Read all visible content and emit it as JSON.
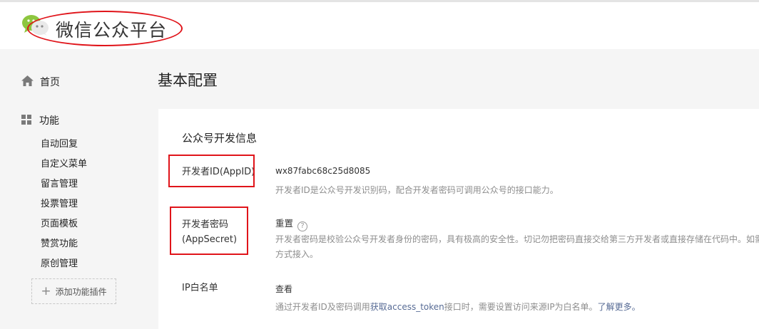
{
  "header": {
    "brand": "微信公众平台",
    "accent": "#8dc63f"
  },
  "sidebar": {
    "home": "首页",
    "function": "功能",
    "items": [
      "自动回复",
      "自定义菜单",
      "留言管理",
      "投票管理",
      "页面模板",
      "赞赏功能",
      "原创管理"
    ],
    "add_plugin": "添加功能插件"
  },
  "main": {
    "title": "基本配置",
    "section_title": "公众号开发信息",
    "appid": {
      "label": "开发者ID(AppID)",
      "value": "wx87fabc68c25d8085",
      "desc": "开发者ID是公众号开发识别码，配合开发者密码可调用公众号的接口能力。"
    },
    "secret": {
      "label_line1": "开发者密码",
      "label_line2": "(AppSecret)",
      "action": "重置",
      "help": "?",
      "desc_line1": "开发者密码是校验公众号开发者身份的密码，具有极高的安全性。切记勿把密码直接交给第三方开发者或直接存储在代码中。如需",
      "desc_line2": "方式接入。"
    },
    "ip_whitelist": {
      "label": "IP白名单",
      "action": "查看",
      "desc_prefix": "通过开发者ID及密码调用",
      "desc_link": "获取access_token",
      "desc_middle": "接口时，需要设置访问来源IP为白名单。",
      "desc_more": "了解更多。"
    }
  },
  "colors": {
    "annotation": "#e0141a",
    "link_blue": "#576b95"
  }
}
